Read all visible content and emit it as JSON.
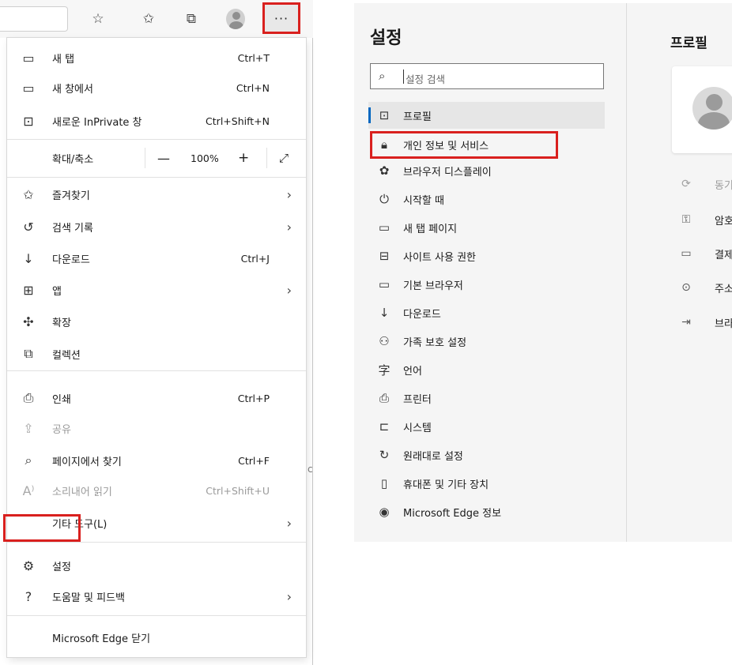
{
  "toolbar": {
    "icons": [
      "favorite-star-add-icon",
      "favorites-list-icon",
      "collections-icon",
      "profile-avatar-icon"
    ],
    "more_label": "···"
  },
  "menu": {
    "new_tab": {
      "label": "새 탭",
      "shortcut": "Ctrl+T",
      "icon": "new-tab-icon"
    },
    "new_window": {
      "label": "새 창에서",
      "shortcut": "Ctrl+N",
      "icon": "new-window-icon"
    },
    "inprivate": {
      "label": "새로운 InPrivate 창",
      "shortcut": "Ctrl+Shift+N",
      "icon": "inprivate-icon"
    },
    "zoom": {
      "label": "확대/축소",
      "minus": "—",
      "value": "100%",
      "plus": "+",
      "fullscreen": "⤢"
    },
    "favorites": {
      "label": "즐겨찾기",
      "icon": "favorites-icon"
    },
    "history": {
      "label": "검색 기록",
      "icon": "history-icon"
    },
    "downloads": {
      "label": "다운로드",
      "shortcut": "Ctrl+J",
      "icon": "download-icon"
    },
    "apps": {
      "label": "앱",
      "icon": "apps-icon"
    },
    "extensions": {
      "label": "확장",
      "icon": "extensions-icon"
    },
    "collections": {
      "label": "컬렉션",
      "icon": "collections-icon"
    },
    "print": {
      "label": "인쇄",
      "shortcut": "Ctrl+P",
      "icon": "print-icon"
    },
    "share": {
      "label": "공유",
      "icon": "share-icon"
    },
    "find": {
      "label": "페이지에서 찾기",
      "shortcut": "Ctrl+F",
      "icon": "find-icon"
    },
    "read_aloud": {
      "label": "소리내어 읽기",
      "shortcut": "Ctrl+Shift+U",
      "icon": "read-aloud-icon"
    },
    "more_tools": {
      "label": "기타 도구(L)"
    },
    "settings": {
      "label": "설정",
      "icon": "gear-icon"
    },
    "help": {
      "label": "도움말 및 피드백",
      "icon": "help-icon"
    },
    "close_edge": {
      "label": "Microsoft Edge 닫기"
    }
  },
  "settings": {
    "title": "설정",
    "search_placeholder": "설정 검색",
    "nav": [
      {
        "label": "프로필",
        "icon": "profile-icon",
        "active": true
      },
      {
        "label": "개인 정보 및 서비스",
        "icon": "lock-icon"
      },
      {
        "label": "브라우저 디스플레이",
        "icon": "palette-icon"
      },
      {
        "label": "시작할 때",
        "icon": "power-icon"
      },
      {
        "label": "새 탭 페이지",
        "icon": "new-tab-page-icon"
      },
      {
        "label": "사이트 사용 권한",
        "icon": "site-permissions-icon"
      },
      {
        "label": "기본 브라우저",
        "icon": "default-browser-icon"
      },
      {
        "label": "다운로드",
        "icon": "download-icon"
      },
      {
        "label": "가족 보호 설정",
        "icon": "family-icon"
      },
      {
        "label": "언어",
        "icon": "language-icon"
      },
      {
        "label": "프린터",
        "icon": "printer-icon"
      },
      {
        "label": "시스템",
        "icon": "system-icon"
      },
      {
        "label": "원래대로 설정",
        "icon": "reset-icon"
      },
      {
        "label": "휴대폰 및 기타 장치",
        "icon": "phone-icon"
      },
      {
        "label": "Microsoft Edge 정보",
        "icon": "edge-logo-icon"
      }
    ]
  },
  "profile": {
    "title": "프로필",
    "rows": [
      {
        "label": "동기",
        "icon": "sync-icon",
        "dim": true
      },
      {
        "label": "암호",
        "icon": "key-icon"
      },
      {
        "label": "결제",
        "icon": "payment-card-icon"
      },
      {
        "label": "주소",
        "icon": "location-pin-icon"
      },
      {
        "label": "브라",
        "icon": "import-browser-icon"
      }
    ]
  },
  "colors": {
    "highlight": "#d9201e",
    "active_nav_bar": "#0067c0"
  }
}
